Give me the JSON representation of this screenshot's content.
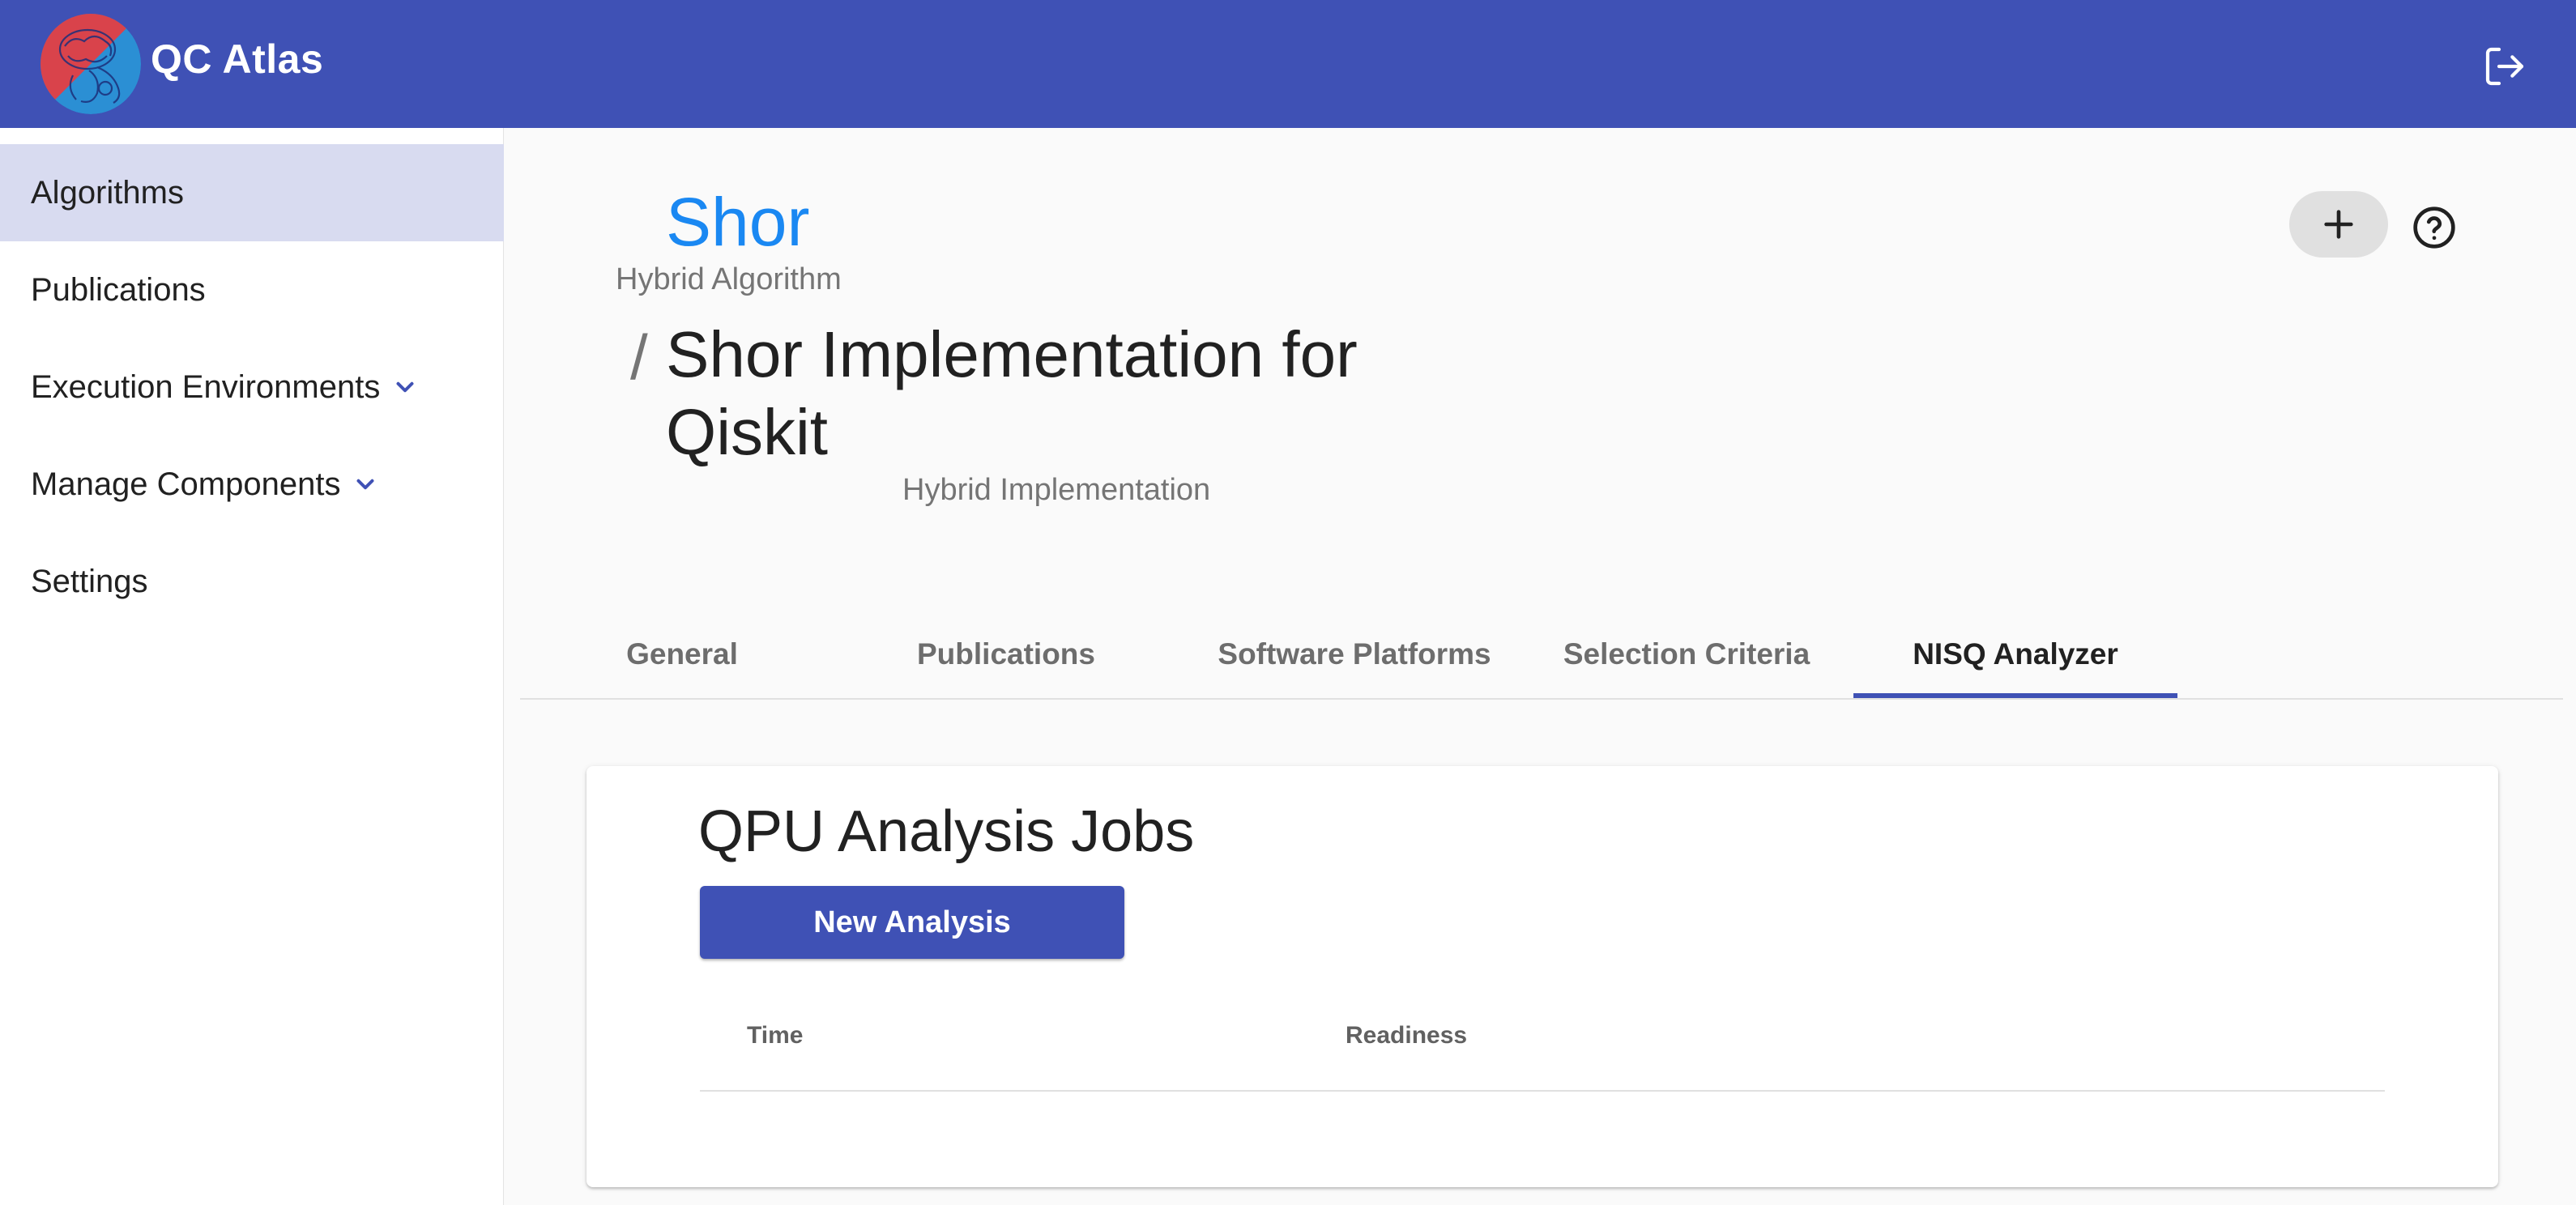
{
  "app": {
    "title": "QC Atlas",
    "logo_icon": "qc-atlas-logo",
    "logout_icon": "logout-icon"
  },
  "colors": {
    "primary": "#3f51b5",
    "link": "#1a88f2",
    "sidebar_active": "#d8dbf0"
  },
  "sidebar": {
    "items": [
      {
        "label": "Algorithms",
        "active": true,
        "expandable": false
      },
      {
        "label": "Publications",
        "active": false,
        "expandable": false
      },
      {
        "label": "Execution Environments",
        "active": false,
        "expandable": true
      },
      {
        "label": "Manage Components",
        "active": false,
        "expandable": true
      },
      {
        "label": "Settings",
        "active": false,
        "expandable": false
      }
    ]
  },
  "header": {
    "algorithm_name": "Shor",
    "algorithm_type": "Hybrid Algorithm",
    "separator": "/",
    "implementation_name": "Shor Implementation for Qiskit",
    "implementation_type": "Hybrid Implementation",
    "add_icon": "plus-icon",
    "help_icon": "help-circle-icon"
  },
  "tabs": [
    {
      "label": "General",
      "active": false
    },
    {
      "label": "Publications",
      "active": false
    },
    {
      "label": "Software Platforms",
      "active": false
    },
    {
      "label": "Selection Criteria",
      "active": false
    },
    {
      "label": "NISQ Analyzer",
      "active": true
    }
  ],
  "analysis": {
    "title": "QPU Analysis Jobs",
    "new_button": "New Analysis",
    "columns": [
      "Time",
      "Readiness"
    ],
    "rows": []
  }
}
